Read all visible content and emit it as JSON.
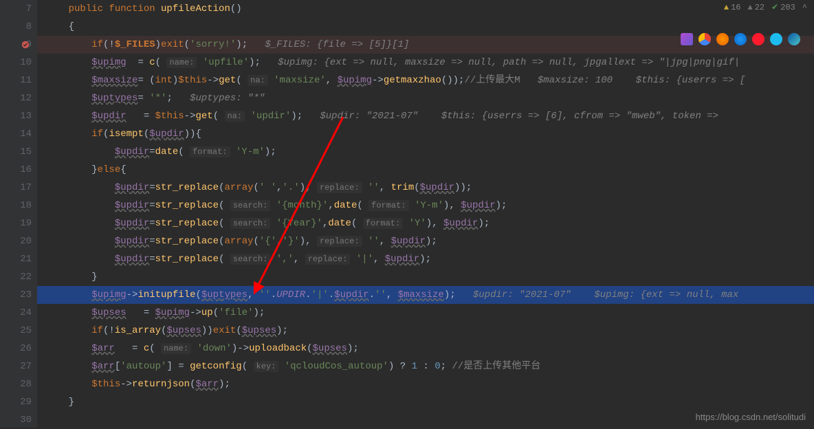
{
  "inspections": {
    "warnings": "16",
    "weakWarnings": "22",
    "typos": "203"
  },
  "watermark": "https://blog.csdn.net/solitudi",
  "lines": {
    "7": "7",
    "8": "8",
    "9": "9",
    "10": "10",
    "11": "11",
    "12": "12",
    "13": "13",
    "14": "14",
    "15": "15",
    "16": "16",
    "17": "17",
    "18": "18",
    "19": "19",
    "20": "20",
    "21": "21",
    "22": "22",
    "23": "23",
    "24": "24",
    "25": "25",
    "26": "26",
    "27": "27",
    "28": "28",
    "29": "29",
    "30": "30"
  },
  "code": {
    "l7_public": "public function ",
    "l7_fn": "upfileAction",
    "l7_paren": "()",
    "l8": "{",
    "l9_1": "if",
    "l9_2": "(!",
    "l9_3": "$_FILES",
    "l9_4": ")",
    "l9_5": "exit",
    "l9_6": "(",
    "l9_7": "'sorry!'",
    "l9_8": ");   ",
    "l9_9": "$_FILES: {file => [5]}[1]",
    "l10_1": "$upimg",
    "l10_2": "  = ",
    "l10_3": "c",
    "l10_4": "( ",
    "l10_h1": "name:",
    "l10_5": " 'upfile'",
    "l10_6": ");   ",
    "l10_i1": "$upimg: {ext => null, maxsize => null, path => null, jpgallext => \"|jpg|png|gif|",
    "l11_1": "$maxsize",
    "l11_2": "= (",
    "l11_3": "int",
    "l11_4": ")",
    "l11_5": "$this",
    "l11_6": "->",
    "l11_7": "get",
    "l11_8": "( ",
    "l11_h1": "na:",
    "l11_9": " 'maxsize'",
    "l11_10": ", ",
    "l11_11": "$upimg",
    "l11_12": "->",
    "l11_13": "getmaxzhao",
    "l11_14": "());",
    "l11_c": "//上传最大M   ",
    "l11_i1": "$maxsize: 100    $this: {userrs => [",
    "l12_1": "$uptypes",
    "l12_2": "= ",
    "l12_3": "'*'",
    "l12_4": ";   ",
    "l12_i1": "$uptypes: \"*\"",
    "l13_1": "$updir",
    "l13_2": "   = ",
    "l13_3": "$this",
    "l13_4": "->",
    "l13_5": "get",
    "l13_6": "( ",
    "l13_h1": "na:",
    "l13_7": " 'updir'",
    "l13_8": ");   ",
    "l13_i1": "$updir: \"2021-07\"    $this: {userrs => [6], cfrom => \"mweb\", token => ",
    "l14_1": "if",
    "l14_2": "(",
    "l14_3": "isempt",
    "l14_4": "(",
    "l14_5": "$updir",
    "l14_6": ")){",
    "l15_1": "$updir",
    "l15_2": "=",
    "l15_3": "date",
    "l15_4": "( ",
    "l15_h1": "format:",
    "l15_5": " 'Y-m'",
    "l15_6": ");",
    "l16_1": "}",
    "l16_2": "else",
    "l16_3": "{",
    "l17_1": "$updir",
    "l17_2": "=",
    "l17_3": "str_replace",
    "l17_4": "(",
    "l17_5": "array",
    "l17_6": "(",
    "l17_7": "' '",
    "l17_8": ",",
    "l17_9": "'.'",
    "l17_10": "), ",
    "l17_h1": "replace:",
    "l17_11": " ''",
    "l17_12": ", ",
    "l17_13": "trim",
    "l17_14": "(",
    "l17_15": "$updir",
    "l17_16": "));",
    "l18_1": "$updir",
    "l18_2": "=",
    "l18_3": "str_replace",
    "l18_4": "( ",
    "l18_h1": "search:",
    "l18_5": " '{month}'",
    "l18_6": ",",
    "l18_7": "date",
    "l18_8": "( ",
    "l18_h2": "format:",
    "l18_9": " 'Y-m'",
    "l18_10": "), ",
    "l18_11": "$updir",
    "l18_12": ");",
    "l19_1": "$updir",
    "l19_2": "=",
    "l19_3": "str_replace",
    "l19_4": "( ",
    "l19_h1": "search:",
    "l19_5": " '{Year}'",
    "l19_6": ",",
    "l19_7": "date",
    "l19_8": "( ",
    "l19_h2": "format:",
    "l19_9": " 'Y'",
    "l19_10": "), ",
    "l19_11": "$updir",
    "l19_12": ");",
    "l20_1": "$updir",
    "l20_2": "=",
    "l20_3": "str_replace",
    "l20_4": "(",
    "l20_5": "array",
    "l20_6": "(",
    "l20_7": "'{'",
    "l20_8": ",",
    "l20_9": "'}'",
    "l20_10": "), ",
    "l20_h1": "replace:",
    "l20_11": " ''",
    "l20_12": ", ",
    "l20_13": "$updir",
    "l20_14": ");",
    "l21_1": "$updir",
    "l21_2": "=",
    "l21_3": "str_replace",
    "l21_4": "( ",
    "l21_h1": "search:",
    "l21_5": " ','",
    "l21_6": ", ",
    "l21_h2": "replace:",
    "l21_7": " '|'",
    "l21_8": ", ",
    "l21_9": "$updir",
    "l21_10": ");",
    "l22": "}",
    "l23_1": "$upimg",
    "l23_2": "->",
    "l23_3": "initupfile",
    "l23_4": "(",
    "l23_5": "$uptypes",
    "l23_6": ", ",
    "l23_7": "''",
    "l23_8": ".",
    "l23_9": "UPDIR",
    "l23_10": ".",
    "l23_11": "'|'",
    "l23_12": ".",
    "l23_13": "$updir",
    "l23_14": ".",
    "l23_15": "''",
    "l23_16": ", ",
    "l23_17": "$maxsize",
    "l23_18": ");   ",
    "l23_i1": "$updir: \"2021-07\"    $upimg: {ext => null, max",
    "l24_1": "$upses",
    "l24_2": "   = ",
    "l24_3": "$upimg",
    "l24_4": "->",
    "l24_5": "up",
    "l24_6": "(",
    "l24_7": "'file'",
    "l24_8": ");",
    "l25_1": "if",
    "l25_2": "(!",
    "l25_3": "is_array",
    "l25_4": "(",
    "l25_5": "$upses",
    "l25_6": "))",
    "l25_7": "exit",
    "l25_8": "(",
    "l25_9": "$upses",
    "l25_10": ");",
    "l26_1": "$arr",
    "l26_2": "   = ",
    "l26_3": "c",
    "l26_4": "( ",
    "l26_h1": "name:",
    "l26_5": " 'down'",
    "l26_6": ")->",
    "l26_7": "uploadback",
    "l26_8": "(",
    "l26_9": "$upses",
    "l26_10": ");",
    "l27_1": "$arr",
    "l27_2": "[",
    "l27_3": "'autoup'",
    "l27_4": "] = ",
    "l27_5": "getconfig",
    "l27_6": "( ",
    "l27_h1": "key:",
    "l27_7": " 'qcloudCos_autoup'",
    "l27_8": ") ? ",
    "l27_9": "1",
    "l27_10": " : ",
    "l27_11": "0",
    "l27_12": "; ",
    "l27_c": "//是否上传其他平台",
    "l28_1": "$this",
    "l28_2": "->",
    "l28_3": "returnjson",
    "l28_4": "(",
    "l28_5": "$arr",
    "l28_6": ");",
    "l29": "}"
  }
}
